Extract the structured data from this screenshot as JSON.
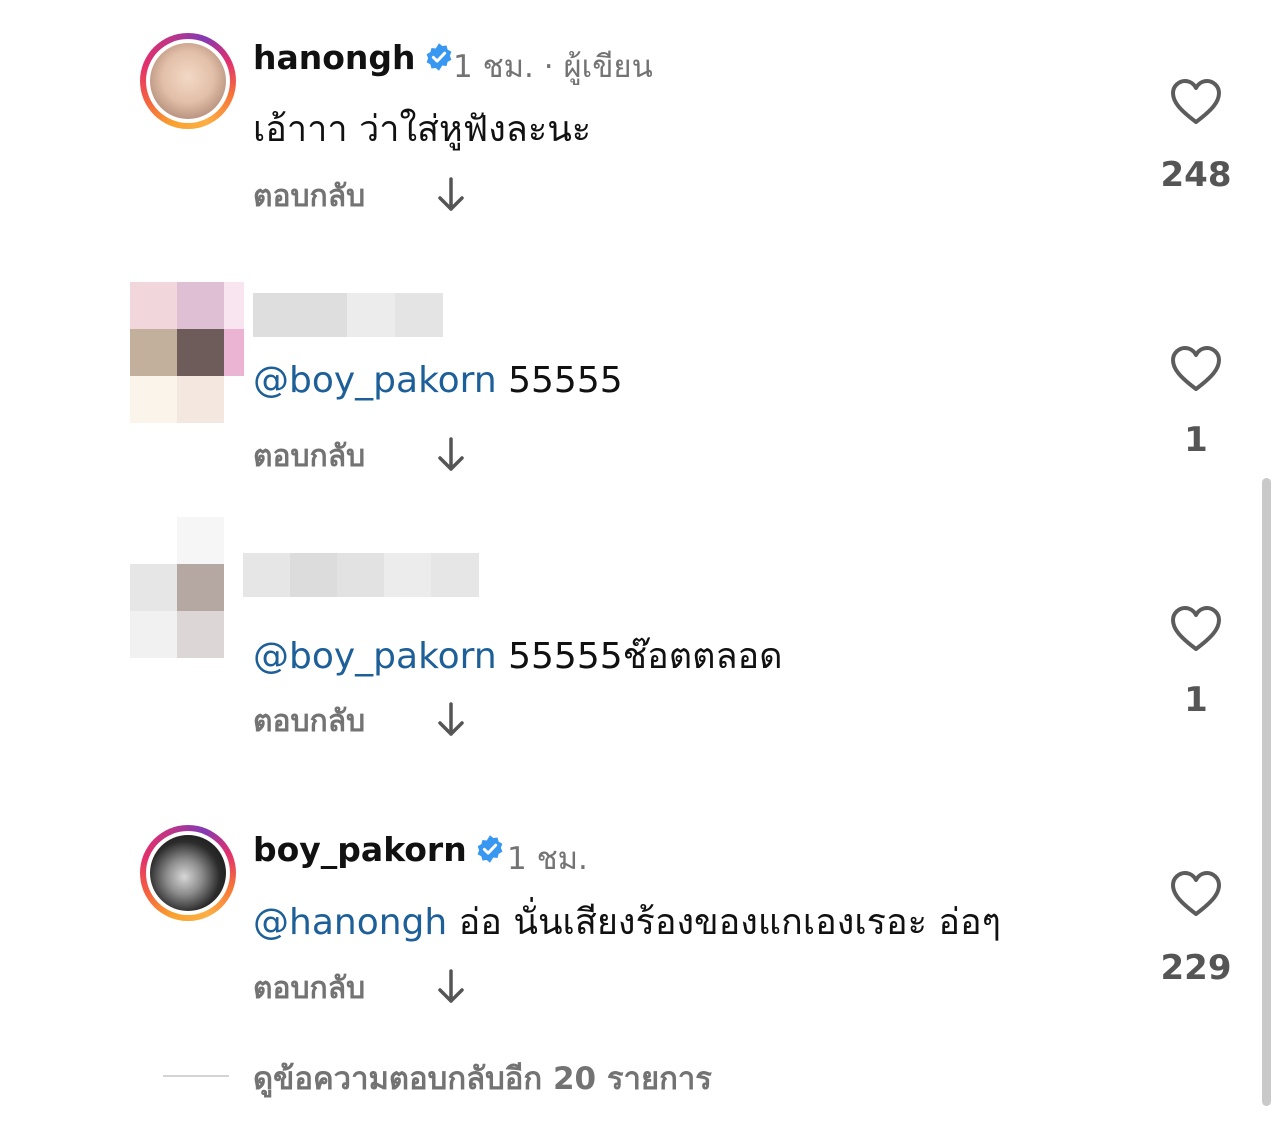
{
  "comments": [
    {
      "username": "hanongh",
      "verified": true,
      "time": "1 ชม.",
      "tag": "· ผู้เขียน",
      "mention": "",
      "text": "เอ้าาา ว่าใส่หูฟังละนะ",
      "reply_label": "ตอบกลับ",
      "likes": "248"
    },
    {
      "username": "",
      "verified": false,
      "time": "",
      "tag": "",
      "mention": "@boy_pakorn",
      "text": " 55555",
      "reply_label": "ตอบกลับ",
      "likes": "1"
    },
    {
      "username": "",
      "verified": false,
      "time": "",
      "tag": "",
      "mention": "@boy_pakorn",
      "text": " 55555ช๊อตตลอด",
      "reply_label": "ตอบกลับ",
      "likes": "1"
    },
    {
      "username": "boy_pakorn",
      "verified": true,
      "time": "1 ชม.",
      "tag": "",
      "mention": "@hanongh",
      "text": " อ่อ นั่นเสียงร้องของแกเองเรอะ อ่อๆ",
      "reply_label": "ตอบกลับ",
      "likes": "229"
    }
  ],
  "view_more_replies": "ดูข้อความตอบกลับอีก 20 รายการ",
  "colors": {
    "mention": "#1d5f98",
    "verified": "#3897f0",
    "muted": "#737373"
  },
  "icons": {
    "like": "heart-outline-icon",
    "expand": "arrow-down-icon",
    "verified": "verified-badge-icon"
  }
}
